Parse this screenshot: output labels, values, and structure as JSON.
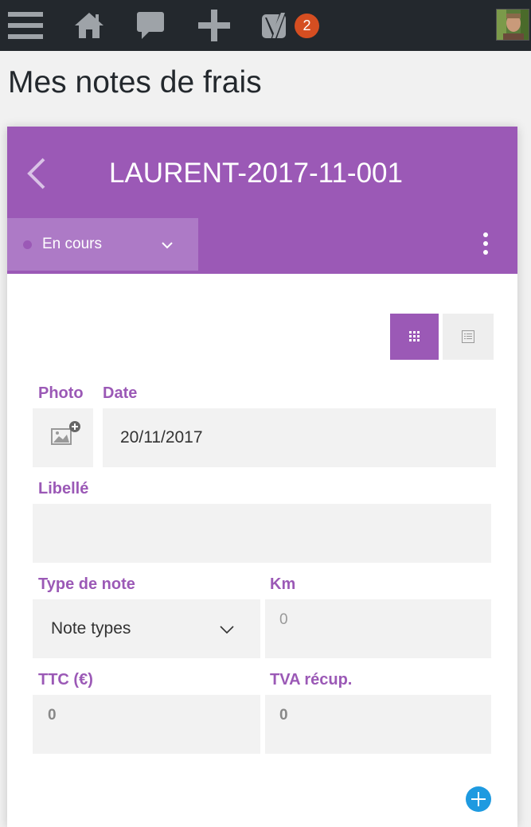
{
  "topbar": {
    "menu_icon": "hamburger-menu-icon",
    "home_icon": "home-icon",
    "comments_icon": "speech-bubble-icon",
    "new_icon": "plus-icon",
    "yoast_icon": "yoast-icon",
    "yoast_badge": "2",
    "avatar_icon": "user-avatar"
  },
  "page": {
    "title": "Mes notes de frais"
  },
  "card": {
    "reference": "LAURENT-2017-11-001",
    "status_label": "En cours",
    "status_color": "#9b59b6",
    "accent_color": "#9b59b6"
  },
  "form": {
    "photo_label": "Photo",
    "date_label": "Date",
    "date_value": "20/11/2017",
    "libelle_label": "Libellé",
    "libelle_value": "",
    "type_label": "Type de note",
    "type_value": "Note types",
    "km_label": "Km",
    "km_placeholder": "0",
    "ttc_label": "TTC (€)",
    "ttc_value": "0",
    "tva_label": "TVA récup.",
    "tva_value": "0"
  }
}
